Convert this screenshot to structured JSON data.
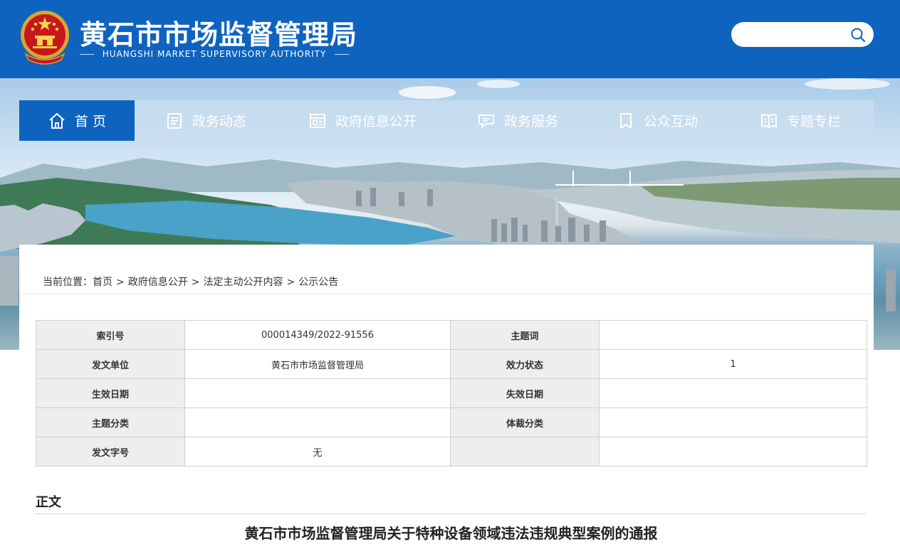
{
  "header": {
    "title": "黄石市市场监督管理局",
    "subtitle": "HUANGSHI MARKET SUPERVISORY AUTHORITY",
    "search_placeholder": "",
    "brand_color": "#0e63bf"
  },
  "nav": {
    "items": [
      {
        "label": "首 页",
        "icon": "home-icon",
        "active": true
      },
      {
        "label": "政务动态",
        "icon": "document-list-icon"
      },
      {
        "label": "政府信息公开",
        "icon": "info-panel-icon"
      },
      {
        "label": "政务服务",
        "icon": "chat-bubble-icon"
      },
      {
        "label": "公众互动",
        "icon": "bookmark-icon"
      },
      {
        "label": "专题专栏",
        "icon": "open-book-icon"
      }
    ]
  },
  "breadcrumb": {
    "prefix": "当前位置：",
    "items": [
      "首页",
      "政府信息公开",
      "法定主动公开内容",
      "公示公告"
    ],
    "separator": ">"
  },
  "meta_table": {
    "rows": [
      {
        "k1": "索引号",
        "v1": "000014349/2022-91556",
        "k2": "主题词",
        "v2": ""
      },
      {
        "k1": "发文单位",
        "v1": "黄石市市场监督管理局",
        "k2": "效力状态",
        "v2": "1"
      },
      {
        "k1": "生效日期",
        "v1": "",
        "k2": "失效日期",
        "v2": ""
      },
      {
        "k1": "主题分类",
        "v1": "",
        "k2": "体裁分类",
        "v2": ""
      },
      {
        "k1": "发文字号",
        "v1": "无",
        "k2": "",
        "v2": ""
      }
    ]
  },
  "body": {
    "section_label": "正文",
    "doc_title": "黄石市市场监督管理局关于特种设备领域违法违规典型案例的通报"
  }
}
